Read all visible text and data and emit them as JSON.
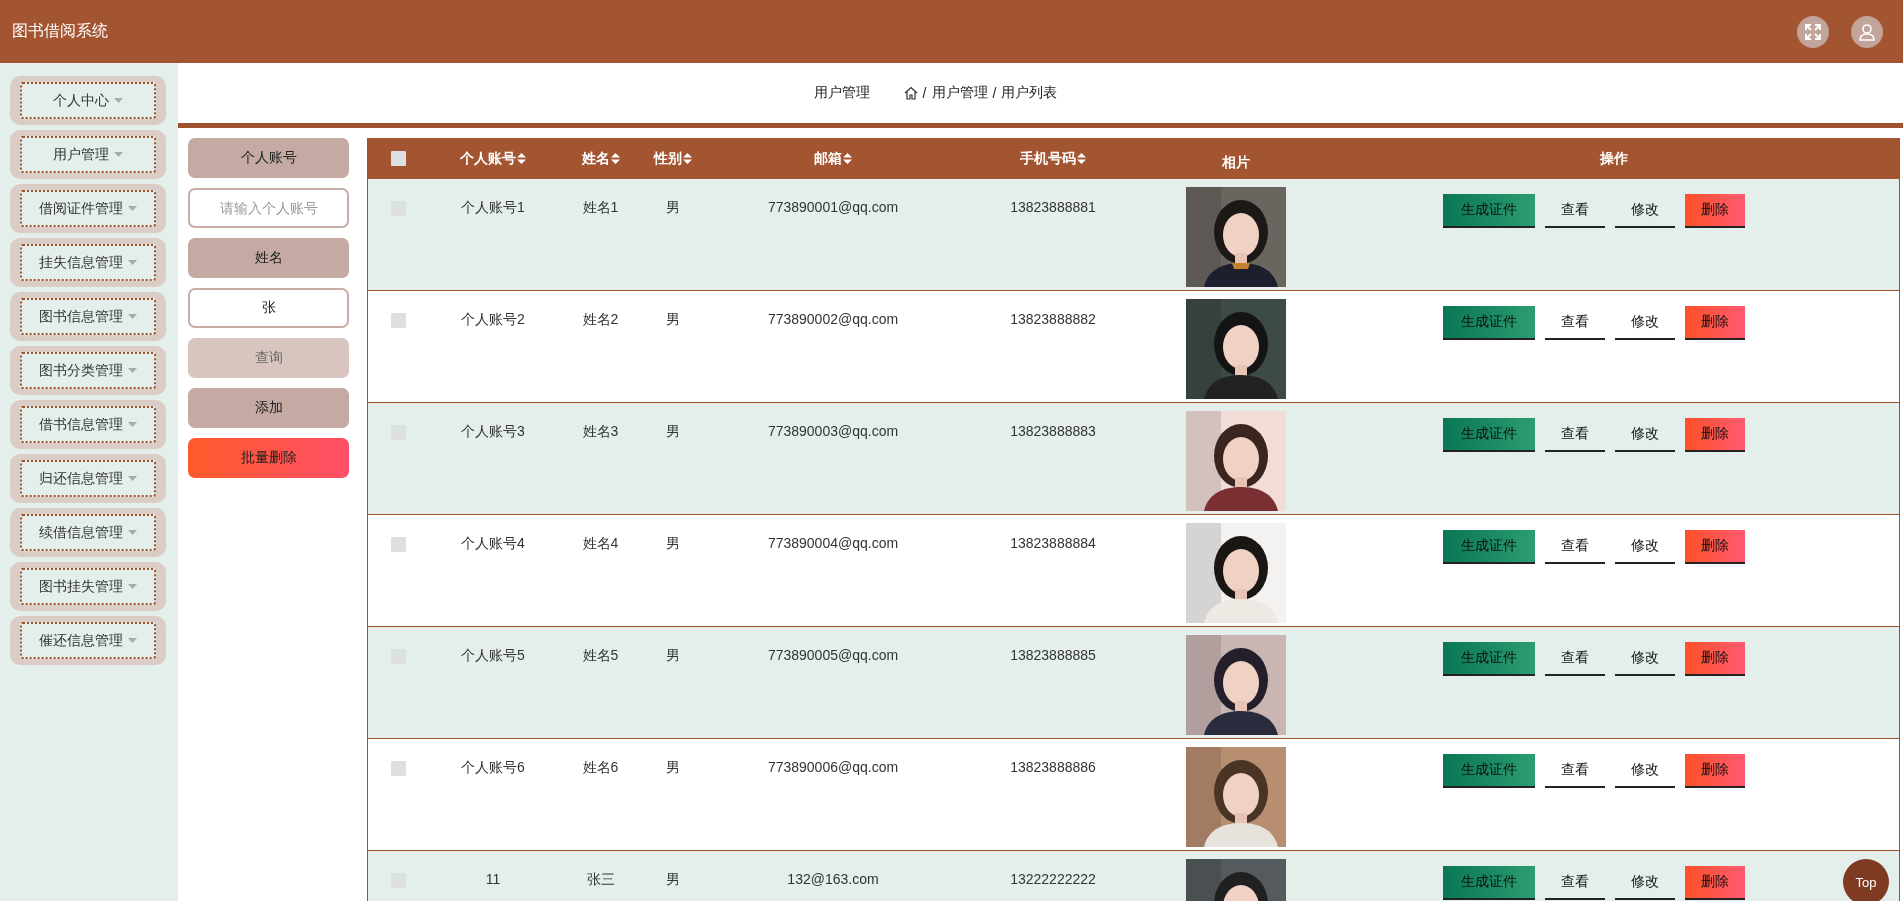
{
  "app": {
    "title": "图书借阅系统"
  },
  "sidebar": {
    "items": [
      {
        "label": "个人中心"
      },
      {
        "label": "用户管理"
      },
      {
        "label": "借阅证件管理"
      },
      {
        "label": "挂失信息管理"
      },
      {
        "label": "图书信息管理"
      },
      {
        "label": "图书分类管理"
      },
      {
        "label": "借书信息管理"
      },
      {
        "label": "归还信息管理"
      },
      {
        "label": "续借信息管理"
      },
      {
        "label": "图书挂失管理"
      },
      {
        "label": "催还信息管理"
      }
    ]
  },
  "breadcrumb": {
    "title": "用户管理",
    "separator": "/",
    "path": [
      "用户管理",
      "用户列表"
    ]
  },
  "search": {
    "fields": [
      {
        "label": "个人账号",
        "placeholder": "请输入个人账号"
      },
      {
        "label": "姓名",
        "value": "张"
      }
    ],
    "buttons": [
      {
        "label": "查询",
        "kind": "query",
        "hovered": true
      },
      {
        "label": "添加",
        "kind": "add",
        "hovered": false
      },
      {
        "label": "批量删除",
        "kind": "danger",
        "hovered": false
      }
    ]
  },
  "table": {
    "select_all": {
      "checked": false
    },
    "columns": [
      {
        "label": "个人账号",
        "sortable": true
      },
      {
        "label": "姓名",
        "sortable": true
      },
      {
        "label": "性别",
        "sortable": true
      },
      {
        "label": "邮箱",
        "sortable": true
      },
      {
        "label": "手机号码",
        "sortable": true
      },
      {
        "label": "相片",
        "sortable": false
      },
      {
        "label": "操作",
        "sortable": false
      }
    ],
    "rows": [
      {
        "checked": false,
        "account": "个人账号1",
        "name": "姓名1",
        "gender": "男",
        "email": "773890001@qq.com",
        "phone": "13823888881",
        "actions": [
          {
            "label": "生成证件",
            "kind": "generate"
          },
          {
            "label": "查看",
            "kind": "plain"
          },
          {
            "label": "修改",
            "kind": "plain"
          },
          {
            "label": "删除",
            "kind": "delete"
          }
        ]
      },
      {
        "checked": false,
        "account": "个人账号2",
        "name": "姓名2",
        "gender": "男",
        "email": "773890002@qq.com",
        "phone": "13823888882",
        "actions": [
          {
            "label": "生成证件",
            "kind": "generate"
          },
          {
            "label": "查看",
            "kind": "plain"
          },
          {
            "label": "修改",
            "kind": "plain"
          },
          {
            "label": "删除",
            "kind": "delete"
          }
        ]
      },
      {
        "checked": false,
        "account": "个人账号3",
        "name": "姓名3",
        "gender": "男",
        "email": "773890003@qq.com",
        "phone": "13823888883",
        "actions": [
          {
            "label": "生成证件",
            "kind": "generate"
          },
          {
            "label": "查看",
            "kind": "plain"
          },
          {
            "label": "修改",
            "kind": "plain"
          },
          {
            "label": "删除",
            "kind": "delete"
          }
        ]
      },
      {
        "checked": false,
        "account": "个人账号4",
        "name": "姓名4",
        "gender": "男",
        "email": "773890004@qq.com",
        "phone": "13823888884",
        "actions": [
          {
            "label": "生成证件",
            "kind": "generate"
          },
          {
            "label": "查看",
            "kind": "plain"
          },
          {
            "label": "修改",
            "kind": "plain"
          },
          {
            "label": "删除",
            "kind": "delete"
          }
        ]
      },
      {
        "checked": false,
        "account": "个人账号5",
        "name": "姓名5",
        "gender": "男",
        "email": "773890005@qq.com",
        "phone": "13823888885",
        "actions": [
          {
            "label": "生成证件",
            "kind": "generate"
          },
          {
            "label": "查看",
            "kind": "plain"
          },
          {
            "label": "修改",
            "kind": "plain"
          },
          {
            "label": "删除",
            "kind": "delete"
          }
        ]
      },
      {
        "checked": false,
        "account": "个人账号6",
        "name": "姓名6",
        "gender": "男",
        "email": "773890006@qq.com",
        "phone": "13823888886",
        "actions": [
          {
            "label": "生成证件",
            "kind": "generate"
          },
          {
            "label": "查看",
            "kind": "plain"
          },
          {
            "label": "修改",
            "kind": "plain"
          },
          {
            "label": "删除",
            "kind": "delete"
          }
        ]
      },
      {
        "checked": false,
        "account": "11",
        "name": "张三",
        "gender": "男",
        "email": "132@163.com",
        "phone": "13222222222",
        "actions": [
          {
            "label": "生成证件",
            "kind": "generate"
          },
          {
            "label": "查看",
            "kind": "plain"
          },
          {
            "label": "修改",
            "kind": "plain"
          },
          {
            "label": "删除",
            "kind": "delete"
          }
        ]
      }
    ]
  },
  "top_button": {
    "label": "Top"
  }
}
